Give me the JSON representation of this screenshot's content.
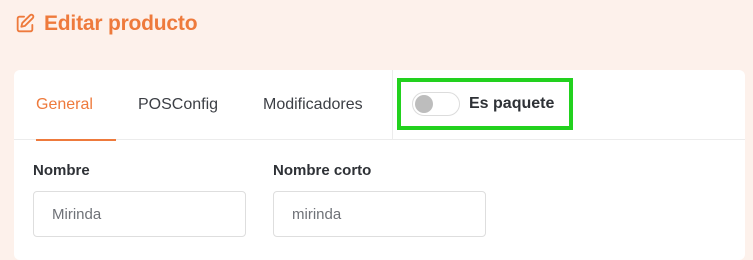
{
  "header": {
    "title": "Editar producto",
    "icon": "edit-square-icon"
  },
  "tabs": [
    {
      "label": "General",
      "active": true
    },
    {
      "label": "POSConfig",
      "active": false
    },
    {
      "label": "Modificadores",
      "active": false
    }
  ],
  "package_toggle": {
    "label": "Es paquete",
    "checked": false
  },
  "form": {
    "name": {
      "label": "Nombre",
      "value": "Mirinda"
    },
    "short_name": {
      "label": "Nombre corto",
      "value": "mirinda"
    }
  },
  "colors": {
    "accent": "#ee7a3c",
    "highlight": "#22d11e",
    "background": "#fdf1eb"
  }
}
